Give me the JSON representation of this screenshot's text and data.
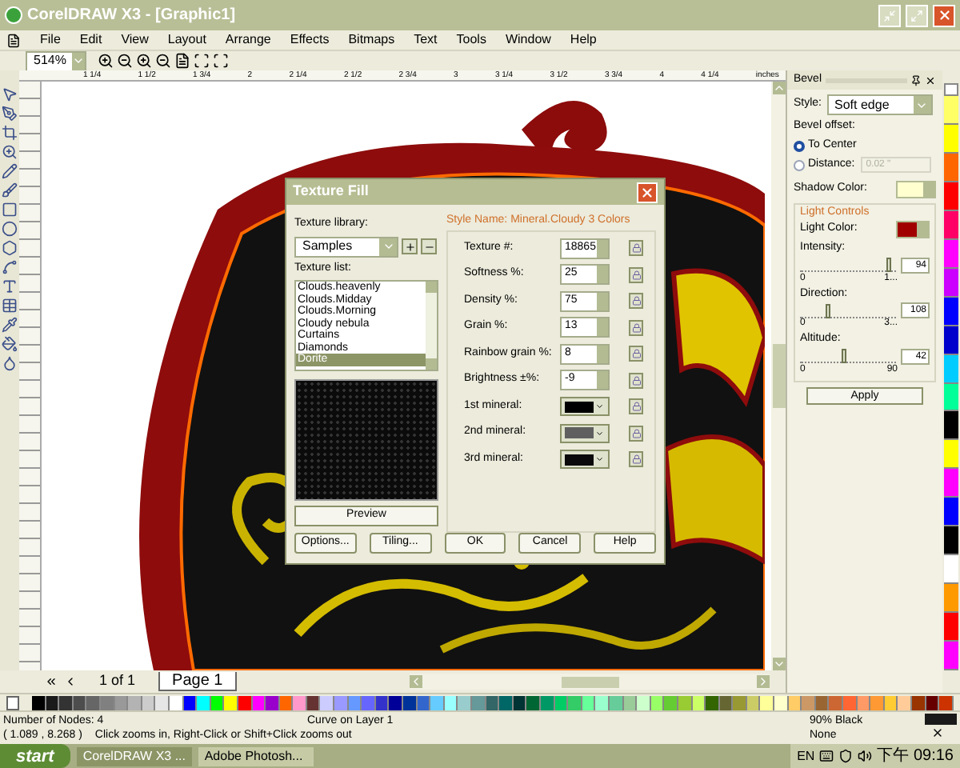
{
  "window": {
    "title": "CorelDRAW X3 - [Graphic1]"
  },
  "menu": [
    "File",
    "Edit",
    "View",
    "Layout",
    "Arrange",
    "Effects",
    "Bitmaps",
    "Text",
    "Tools",
    "Window",
    "Help"
  ],
  "toolbar": {
    "zoom": "514%"
  },
  "ruler": {
    "ticks": [
      "1 1/4",
      "1 1/2",
      "1 3/4",
      "2",
      "2 1/4",
      "2 1/2",
      "2 3/4",
      "3",
      "3 1/4",
      "3 1/2",
      "3 3/4",
      "4",
      "4 1/4"
    ],
    "unit": "inches"
  },
  "dialog": {
    "title": "Texture Fill",
    "library_label": "Texture library:",
    "library": "Samples",
    "list_label": "Texture list:",
    "list": [
      {
        "label": "Clouds.heavenly",
        "selected": false
      },
      {
        "label": "Clouds.Midday",
        "selected": false
      },
      {
        "label": "Clouds.Morning",
        "selected": false
      },
      {
        "label": "Cloudy nebula",
        "selected": false
      },
      {
        "label": "Curtains",
        "selected": false
      },
      {
        "label": "Diamonds",
        "selected": false
      },
      {
        "label": "Dorite",
        "selected": true
      }
    ],
    "preview_button": "Preview",
    "style_name": "Style Name: Mineral.Cloudy 3 Colors",
    "params": [
      {
        "kind": "number",
        "label": "Texture #:",
        "value": "18865"
      },
      {
        "kind": "number",
        "label": "Softness %:",
        "value": "25"
      },
      {
        "kind": "number",
        "label": "Density %:",
        "value": "75"
      },
      {
        "kind": "number",
        "label": "Grain %:",
        "value": "13"
      },
      {
        "kind": "number",
        "label": "Rainbow grain %:",
        "value": "8"
      },
      {
        "kind": "number",
        "label": "Brightness ±%:",
        "value": "-9"
      },
      {
        "kind": "color",
        "label": "1st mineral:",
        "color": "#000000"
      },
      {
        "kind": "color",
        "label": "2nd mineral:",
        "color": "#5f5f5f"
      },
      {
        "kind": "color",
        "label": "3rd mineral:",
        "color": "#0a0a0a"
      }
    ],
    "buttons": [
      "Options...",
      "Tiling...",
      "OK",
      "Cancel",
      "Help"
    ]
  },
  "docker": {
    "title": "Bevel",
    "style_label": "Style:",
    "style": "Soft edge",
    "offset_label": "Bevel offset:",
    "offsets": [
      {
        "label": "To Center",
        "selected": true
      },
      {
        "label": "Distance:",
        "selected": false
      }
    ],
    "distance": "0.02 \"",
    "shadow_label": "Shadow Color:",
    "shadow": {
      "color": "#ffffd0"
    },
    "group": "Light Controls",
    "light_label": "Light Color:",
    "light": {
      "color": "#a00000"
    },
    "sliders": [
      {
        "label": "Intensity:",
        "value": "94",
        "level": 0.94,
        "min": "0",
        "max": "1..."
      },
      {
        "label": "Direction:",
        "value": "108",
        "level": 0.3,
        "min": "0",
        "max": "3..."
      },
      {
        "label": "Altitude:",
        "value": "42",
        "level": 0.47,
        "min": "0",
        "max": "90"
      }
    ],
    "apply": "Apply"
  },
  "page_nav": {
    "count": "1 of 1",
    "tab": "Page 1"
  },
  "palette": [
    {
      "color": "#000000"
    },
    {
      "color": "#1a1a1a"
    },
    {
      "color": "#333333"
    },
    {
      "color": "#4d4d4d"
    },
    {
      "color": "#666666"
    },
    {
      "color": "#808080"
    },
    {
      "color": "#999999"
    },
    {
      "color": "#b3b3b3"
    },
    {
      "color": "#cccccc"
    },
    {
      "color": "#e6e6e6"
    },
    {
      "color": "#ffffff"
    },
    {
      "color": "#0000ff"
    },
    {
      "color": "#00ffff"
    },
    {
      "color": "#00ff00"
    },
    {
      "color": "#ffff00"
    },
    {
      "color": "#ff0000"
    },
    {
      "color": "#ff00ff"
    },
    {
      "color": "#9900cc"
    },
    {
      "color": "#ff6600"
    },
    {
      "color": "#ff99cc"
    },
    {
      "color": "#663333"
    },
    {
      "color": "#ccccff"
    },
    {
      "color": "#9999ff"
    },
    {
      "color": "#6699ff"
    },
    {
      "color": "#6666ff"
    },
    {
      "color": "#3333cc"
    },
    {
      "color": "#000099"
    },
    {
      "color": "#003399"
    },
    {
      "color": "#3366cc"
    },
    {
      "color": "#66ccff"
    },
    {
      "color": "#99ffff"
    },
    {
      "color": "#99cccc"
    },
    {
      "color": "#669999"
    },
    {
      "color": "#336666"
    },
    {
      "color": "#006666"
    },
    {
      "color": "#003333"
    },
    {
      "color": "#006633"
    },
    {
      "color": "#009966"
    },
    {
      "color": "#00cc66"
    },
    {
      "color": "#33cc66"
    },
    {
      "color": "#66ff99"
    },
    {
      "color": "#99ffcc"
    },
    {
      "color": "#66cc99"
    },
    {
      "color": "#99cc99"
    },
    {
      "color": "#ccffcc"
    },
    {
      "color": "#99ff66"
    },
    {
      "color": "#66cc33"
    },
    {
      "color": "#99cc33"
    },
    {
      "color": "#ccff66"
    },
    {
      "color": "#336600"
    },
    {
      "color": "#666633"
    },
    {
      "color": "#999933"
    },
    {
      "color": "#cccc66"
    },
    {
      "color": "#ffff99"
    },
    {
      "color": "#ffffcc"
    },
    {
      "color": "#ffcc66"
    },
    {
      "color": "#cc9966"
    },
    {
      "color": "#996633"
    },
    {
      "color": "#cc6633"
    },
    {
      "color": "#ff6633"
    },
    {
      "color": "#ff9966"
    },
    {
      "color": "#ff9933"
    },
    {
      "color": "#ffcc33"
    },
    {
      "color": "#ffcc99"
    },
    {
      "color": "#993300"
    },
    {
      "color": "#660000"
    },
    {
      "color": "#cc3300"
    }
  ],
  "side_palette": [
    {
      "color": "#ffff66"
    },
    {
      "color": "#ffff00"
    },
    {
      "color": "#ff6600"
    },
    {
      "color": "#ff0000"
    },
    {
      "color": "#ff0066"
    },
    {
      "color": "#ff00ff"
    },
    {
      "color": "#cc00ff"
    },
    {
      "color": "#0000ff"
    },
    {
      "color": "#0000cc"
    },
    {
      "color": "#00ccff"
    },
    {
      "color": "#00ff99"
    },
    {
      "color": "#000000"
    },
    {
      "color": "#ffff00"
    },
    {
      "color": "#ff00ff"
    },
    {
      "color": "#0000ff"
    },
    {
      "color": "#000000"
    },
    {
      "color": "#ffffff"
    },
    {
      "color": "#ff9900"
    },
    {
      "color": "#ff0000"
    },
    {
      "color": "#ff00ff"
    }
  ],
  "status": {
    "nodes": "Number of Nodes: 4",
    "layer": "Curve on Layer 1",
    "coords": "( 1.089 , 8.268 )",
    "hint": "Click zooms in, Right-Click or Shift+Click zooms out",
    "fill": {
      "label": "90% Black",
      "color": "#1a1a1a"
    },
    "outline": "None"
  },
  "taskbar": {
    "start": "start",
    "tasks": [
      {
        "label": "CorelDRAW X3 ...",
        "selected": true
      },
      {
        "label": "Adobe Photosh...",
        "selected": false
      }
    ],
    "lang": "EN",
    "clock": "下午 09:16"
  }
}
